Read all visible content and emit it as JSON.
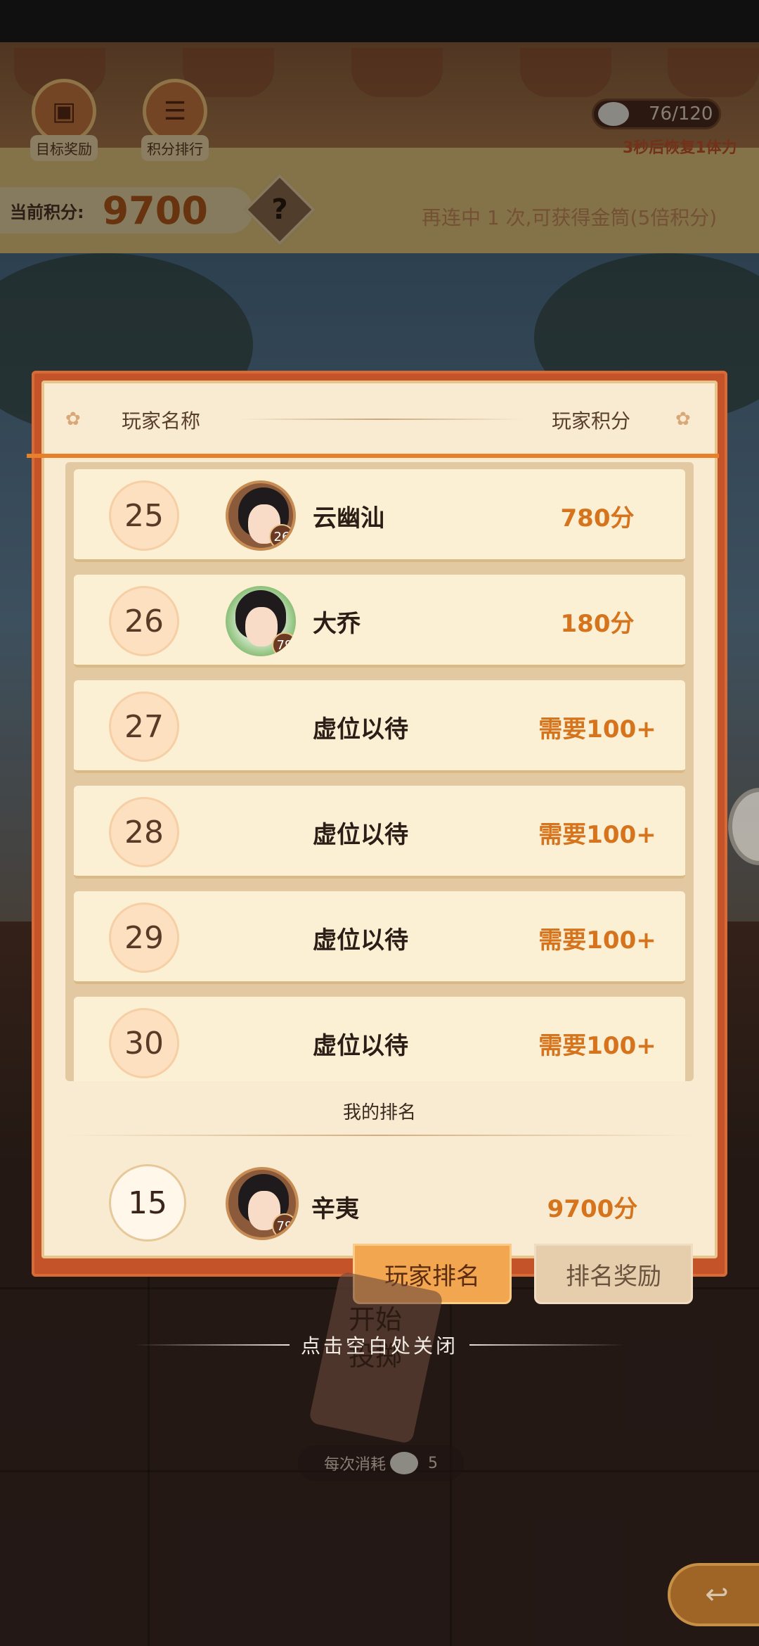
{
  "hud": {
    "goal_reward_label": "目标奖励",
    "score_rank_label": "积分排行",
    "stamina": "76/120",
    "recover_hint": "3秒后恢复1体力",
    "current_score_label": "当前积分:",
    "current_score": "9700",
    "help_symbol": "?",
    "combo_hint": "再连中 1 次,可获得金筒(5倍积分)"
  },
  "panel": {
    "header": {
      "name_col": "玩家名称",
      "score_col": "玩家积分"
    },
    "rows": [
      {
        "rank": "25",
        "name": "云幽汕",
        "level": "26",
        "score": "780分",
        "has_avatar": true
      },
      {
        "rank": "26",
        "name": "大乔",
        "level": "79",
        "score": "180分",
        "has_avatar": true
      },
      {
        "rank": "27",
        "name": "虚位以待",
        "score": "需要100+",
        "has_avatar": false
      },
      {
        "rank": "28",
        "name": "虚位以待",
        "score": "需要100+",
        "has_avatar": false
      },
      {
        "rank": "29",
        "name": "虚位以待",
        "score": "需要100+",
        "has_avatar": false
      },
      {
        "rank": "30",
        "name": "虚位以待",
        "score": "需要100+",
        "has_avatar": false
      }
    ],
    "my_rank": {
      "title": "我的排名",
      "rank": "15",
      "name": "辛夷",
      "level": "79",
      "score": "9700分"
    }
  },
  "tabs": {
    "player_rank": "玩家排名",
    "rank_reward": "排名奖励"
  },
  "footer": {
    "throw_label": "开始投掷",
    "close_hint": "点击空白处关闭",
    "cost_label": "每次消耗",
    "cost_value": "5"
  },
  "colors": {
    "panel_frame": "#c4532a",
    "panel_bg": "#f8ebd2",
    "score_orange": "#d6741e",
    "active_tab": "#f2a650"
  }
}
